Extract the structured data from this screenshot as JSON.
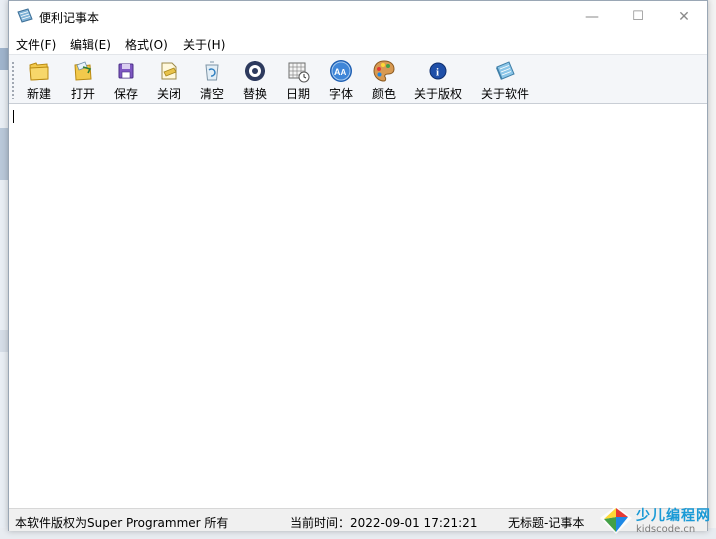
{
  "window": {
    "title": "便利记事本",
    "controls": {
      "minimize": "—",
      "maximize": "☐",
      "close": "✕"
    }
  },
  "menu": {
    "items": [
      {
        "label": "文件(F)"
      },
      {
        "label": "编辑(E)"
      },
      {
        "label": "格式(O)"
      },
      {
        "label": "关于(H)"
      }
    ]
  },
  "toolbar": {
    "buttons": [
      {
        "label": "新建",
        "icon": "folder-icon"
      },
      {
        "label": "打开",
        "icon": "open-icon"
      },
      {
        "label": "保存",
        "icon": "floppy-disk-icon"
      },
      {
        "label": "关闭",
        "icon": "close-document-icon"
      },
      {
        "label": "清空",
        "icon": "recycle-bin-icon"
      },
      {
        "label": "替换",
        "icon": "gear-icon"
      },
      {
        "label": "日期",
        "icon": "calendar-clock-icon"
      },
      {
        "label": "字体",
        "icon": "font-icon"
      },
      {
        "label": "颜色",
        "icon": "palette-icon"
      },
      {
        "label": "关于版权",
        "icon": "info-icon"
      },
      {
        "label": "关于软件",
        "icon": "notebook-icon"
      }
    ]
  },
  "editor": {
    "content": ""
  },
  "statusbar": {
    "copyright": "本软件版权为Super Programmer 所有",
    "time": "当前时间：2022-09-01 17:21:21",
    "document": "无标题-记事本"
  },
  "watermark": {
    "line1": "少儿编程网",
    "line2": "kidscode.cn"
  },
  "colors": {
    "accent": "#1a9ad6",
    "statusbar": "#f0f0f0",
    "toolbar": "#f4f6f9"
  }
}
